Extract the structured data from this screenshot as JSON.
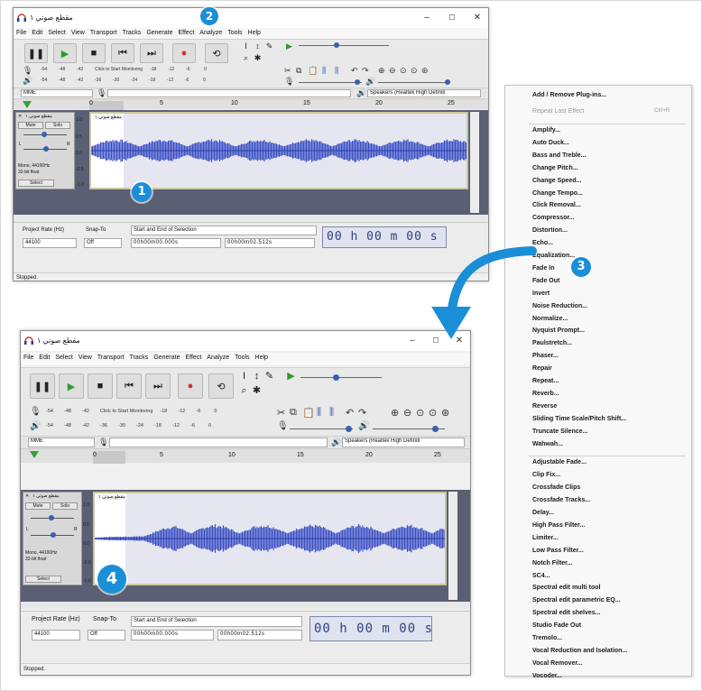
{
  "window": {
    "title": "مقطع صوتي ١",
    "minimize": "–",
    "maximize": "☐",
    "close": "✕"
  },
  "menus": [
    "File",
    "Edit",
    "Select",
    "View",
    "Transport",
    "Tracks",
    "Generate",
    "Effect",
    "Analyze",
    "Tools",
    "Help"
  ],
  "meters": {
    "record_ticks": [
      "-54",
      "-48",
      "-42"
    ],
    "record_click_text": "Click to Start Monitoring",
    "record_ticks_right": [
      "-18",
      "-12",
      "-6",
      "0"
    ],
    "play_ticks": [
      "-54",
      "-48",
      "-42",
      "-36",
      "-30",
      "-24",
      "-18",
      "-12",
      "-6",
      "0"
    ]
  },
  "device": {
    "host": "MME",
    "output": "Speakers (Realtek High Definiti"
  },
  "ruler": [
    "0",
    "5",
    "10",
    "15",
    "20",
    "25"
  ],
  "track": {
    "name": "مقطع صوتي ١",
    "clip_name": "مقطع صوتي ١",
    "mute": "Mute",
    "solo": "Solo",
    "L": "L",
    "R": "R",
    "info1": "Mono, 44100Hz",
    "info2": "32-bit float",
    "select": "Select",
    "y_labels": [
      "1.0",
      "0.5",
      "0.0",
      "-0.5",
      "-1.0"
    ]
  },
  "bottom": {
    "project_rate_label": "Project Rate (Hz)",
    "snap_to_label": "Snap-To",
    "selection_label": "Start and End of Selection",
    "rate": "44100",
    "snap": "Off",
    "sel_start": "00h00m00.000s",
    "sel_end": "00h00m02.512s",
    "time": "00 h 00 m 00 s"
  },
  "status": "Stopped.",
  "badges": {
    "b1": "1",
    "b2": "2",
    "b3": "3",
    "b4": "4"
  },
  "effect_menu": {
    "top": [
      {
        "label": "Add / Remove Plug-ins...",
        "disabled": false
      },
      {
        "label": "Repeat Last Effect",
        "disabled": true,
        "shortcut": "Ctrl+R"
      }
    ],
    "group1": [
      "Amplify...",
      "Auto Duck...",
      "Bass and Treble...",
      "Change Pitch...",
      "Change Speed...",
      "Change Tempo...",
      "Click Removal...",
      "Compressor...",
      "Distortion...",
      "Echo...",
      "Equalization...",
      "Fade In",
      "Fade Out",
      "Invert",
      "Noise Reduction...",
      "Normalize...",
      "Nyquist Prompt...",
      "Paulstretch...",
      "Phaser...",
      "Repair",
      "Repeat...",
      "Reverb...",
      "Reverse",
      "Sliding Time Scale/Pitch Shift...",
      "Truncate Silence...",
      "Wahwah..."
    ],
    "group2": [
      "Adjustable Fade...",
      "Clip Fix...",
      "Crossfade Clips",
      "Crossfade Tracks...",
      "Delay...",
      "High Pass Filter...",
      "Limiter...",
      "Low Pass Filter...",
      "Notch Filter...",
      "SC4...",
      "Spectral edit multi tool",
      "Spectral edit parametric EQ...",
      "Spectral edit shelves...",
      "Studio Fade Out",
      "Tremolo...",
      "Vocal Reduction and Isolation...",
      "Vocal Remover...",
      "Vocoder..."
    ]
  },
  "colors": {
    "badge": "#1a8fd8",
    "wave": "#3b4fc4",
    "arrow": "#1a8fd8"
  }
}
